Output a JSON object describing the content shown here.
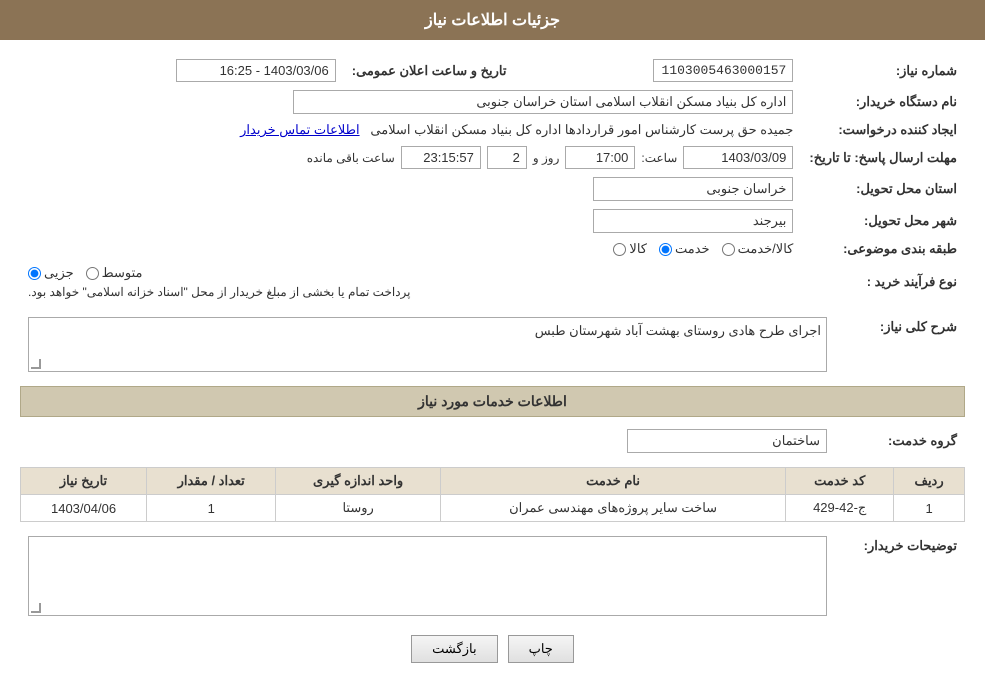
{
  "header": {
    "title": "جزئیات اطلاعات نیاز"
  },
  "fields": {
    "notice_number_label": "شماره نیاز:",
    "notice_number_value": "1103005463000157",
    "announcement_date_label": "تاریخ و ساعت اعلان عمومی:",
    "announcement_date_value": "1403/03/06 - 16:25",
    "buyer_org_label": "نام دستگاه خریدار:",
    "buyer_org_value": "اداره کل بنیاد مسکن انقلاب اسلامی استان خراسان جنوبی",
    "creator_label": "ایجاد کننده درخواست:",
    "creator_value": "جمیده حق پرست کارشناس امور قراردادها اداره کل بنیاد مسکن انقلاب اسلامی",
    "creator_link": "اطلاعات تماس خریدار",
    "response_deadline_label": "مهلت ارسال پاسخ: تا تاریخ:",
    "response_date": "1403/03/09",
    "response_time_label": "ساعت:",
    "response_time": "17:00",
    "response_day_label": "روز و",
    "response_days": "2",
    "response_remaining_label": "ساعت باقی مانده",
    "response_remaining": "23:15:57",
    "province_label": "استان محل تحویل:",
    "province_value": "خراسان جنوبی",
    "city_label": "شهر محل تحویل:",
    "city_value": "بیرجند",
    "category_label": "طبقه بندی موضوعی:",
    "category_options": [
      {
        "label": "کالا",
        "value": "kala"
      },
      {
        "label": "خدمت",
        "value": "khedmat"
      },
      {
        "label": "کالا/خدمت",
        "value": "kala_khedmat"
      }
    ],
    "category_selected": "khedmat",
    "purchase_type_label": "نوع فرآیند خرید :",
    "purchase_options": [
      {
        "label": "جزیی",
        "value": "jozi"
      },
      {
        "label": "متوسط",
        "value": "motavaset"
      }
    ],
    "purchase_selected": "jozi",
    "purchase_notice": "پرداخت تمام یا بخشی از مبلغ خریدار از محل \"اسناد خزانه اسلامی\" خواهد بود.",
    "description_label": "شرح کلی نیاز:",
    "description_value": "اجرای طرح هادی روستای بهشت آباد شهرستان طبس",
    "services_section_title": "اطلاعات خدمات مورد نیاز",
    "service_group_label": "گروه خدمت:",
    "service_group_value": "ساختمان",
    "services_table": {
      "columns": [
        "ردیف",
        "کد خدمت",
        "نام خدمت",
        "واحد اندازه گیری",
        "تعداد / مقدار",
        "تاریخ نیاز"
      ],
      "rows": [
        {
          "index": "1",
          "code": "ج-42-429",
          "name": "ساخت سایر پروژه‌های مهندسی عمران",
          "unit": "روستا",
          "quantity": "1",
          "date": "1403/04/06"
        }
      ]
    },
    "buyer_desc_label": "توضیحات خریدار:",
    "buyer_desc_value": "",
    "buttons": {
      "print": "چاپ",
      "back": "بازگشت"
    }
  }
}
